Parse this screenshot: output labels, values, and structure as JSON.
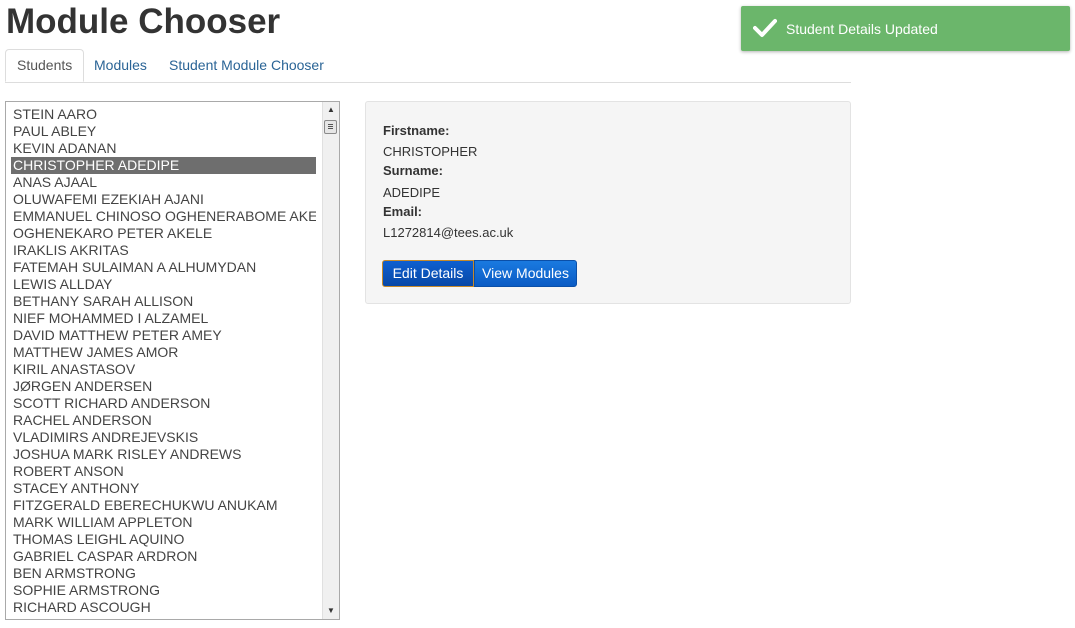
{
  "page": {
    "title": "Module Chooser"
  },
  "tabs": [
    {
      "label": "Students",
      "active": true
    },
    {
      "label": "Modules",
      "active": false
    },
    {
      "label": "Student Module Chooser",
      "active": false
    }
  ],
  "students": {
    "selected_index": 3,
    "items": [
      "STEIN AARO",
      "PAUL ABLEY",
      "KEVIN ADANAN",
      "CHRISTOPHER ADEDIPE",
      "ANAS AJAAL",
      "OLUWAFEMI EZEKIAH AJANI",
      "EMMANUEL CHINOSO OGHENERABOME AKELE",
      "OGHENEKARO PETER AKELE",
      "IRAKLIS AKRITAS",
      "FATEMAH SULAIMAN A ALHUMYDAN",
      "LEWIS ALLDAY",
      "BETHANY SARAH ALLISON",
      "NIEF MOHAMMED I ALZAMEL",
      "DAVID MATTHEW PETER AMEY",
      "MATTHEW JAMES AMOR",
      "KIRIL ANASTASOV",
      "JØRGEN ANDERSEN",
      "SCOTT RICHARD ANDERSON",
      "RACHEL ANDERSON",
      "VLADIMIRS ANDREJEVSKIS",
      "JOSHUA MARK RISLEY ANDREWS",
      "ROBERT ANSON",
      "STACEY ANTHONY",
      "FITZGERALD EBERECHUKWU ANUKAM",
      "MARK WILLIAM APPLETON",
      "THOMAS LEIGHL AQUINO",
      "GABRIEL CASPAR ARDRON",
      "BEN ARMSTRONG",
      "SOPHIE ARMSTRONG",
      "RICHARD ASCOUGH"
    ]
  },
  "details": {
    "firstname_label": "Firstname:",
    "firstname_value": "CHRISTOPHER",
    "surname_label": "Surname:",
    "surname_value": "ADEDIPE",
    "email_label": "Email:",
    "email_value": "L1272814@tees.ac.uk",
    "edit_button": "Edit Details",
    "view_button": "View Modules"
  },
  "toast": {
    "message": "Student Details Updated",
    "icon": "check-icon"
  },
  "colors": {
    "toast_bg": "#6bb66b",
    "selected_row": "#6e6e6e",
    "button_primary": "#0a5bc4",
    "tab_link": "#2a6496"
  }
}
